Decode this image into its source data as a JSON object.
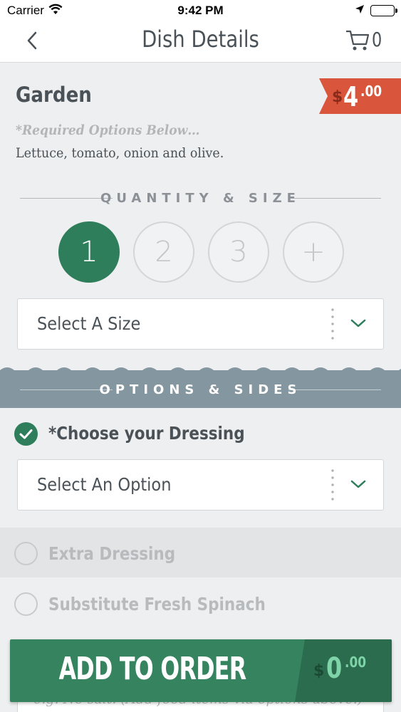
{
  "status_bar": {
    "carrier": "Carrier",
    "time": "9:42 PM"
  },
  "nav": {
    "title": "Dish Details",
    "cart_count": "0"
  },
  "dish": {
    "name": "Garden",
    "price": {
      "currency": "$",
      "whole": "4",
      "cents": ".00"
    },
    "required_note": "*Required Options Below…",
    "description": "Lettuce, tomato, onion and olive."
  },
  "quantity": {
    "heading": "QUANTITY & SIZE",
    "options": [
      "1",
      "2",
      "3",
      "+"
    ],
    "selected": "1"
  },
  "size_select": {
    "value": "Select A Size"
  },
  "options_section": {
    "heading": "OPTIONS & SIDES",
    "dressing": {
      "title": "*Choose your Dressing",
      "select_value": "Select An Option"
    },
    "extras": [
      {
        "label": "Extra Dressing",
        "checked": false
      },
      {
        "label": "Substitute Fresh Spinach",
        "checked": false
      }
    ],
    "notes_placeholder": "e.g. No salt. (Add food items via options above.)"
  },
  "add_to_order": {
    "label": "ADD TO ORDER",
    "total": {
      "currency": "$",
      "whole": "0",
      "cents": ".00"
    }
  },
  "colors": {
    "accent_green": "#2e7d5b",
    "price_red": "#d9553c",
    "band_slate": "#8496a0"
  }
}
